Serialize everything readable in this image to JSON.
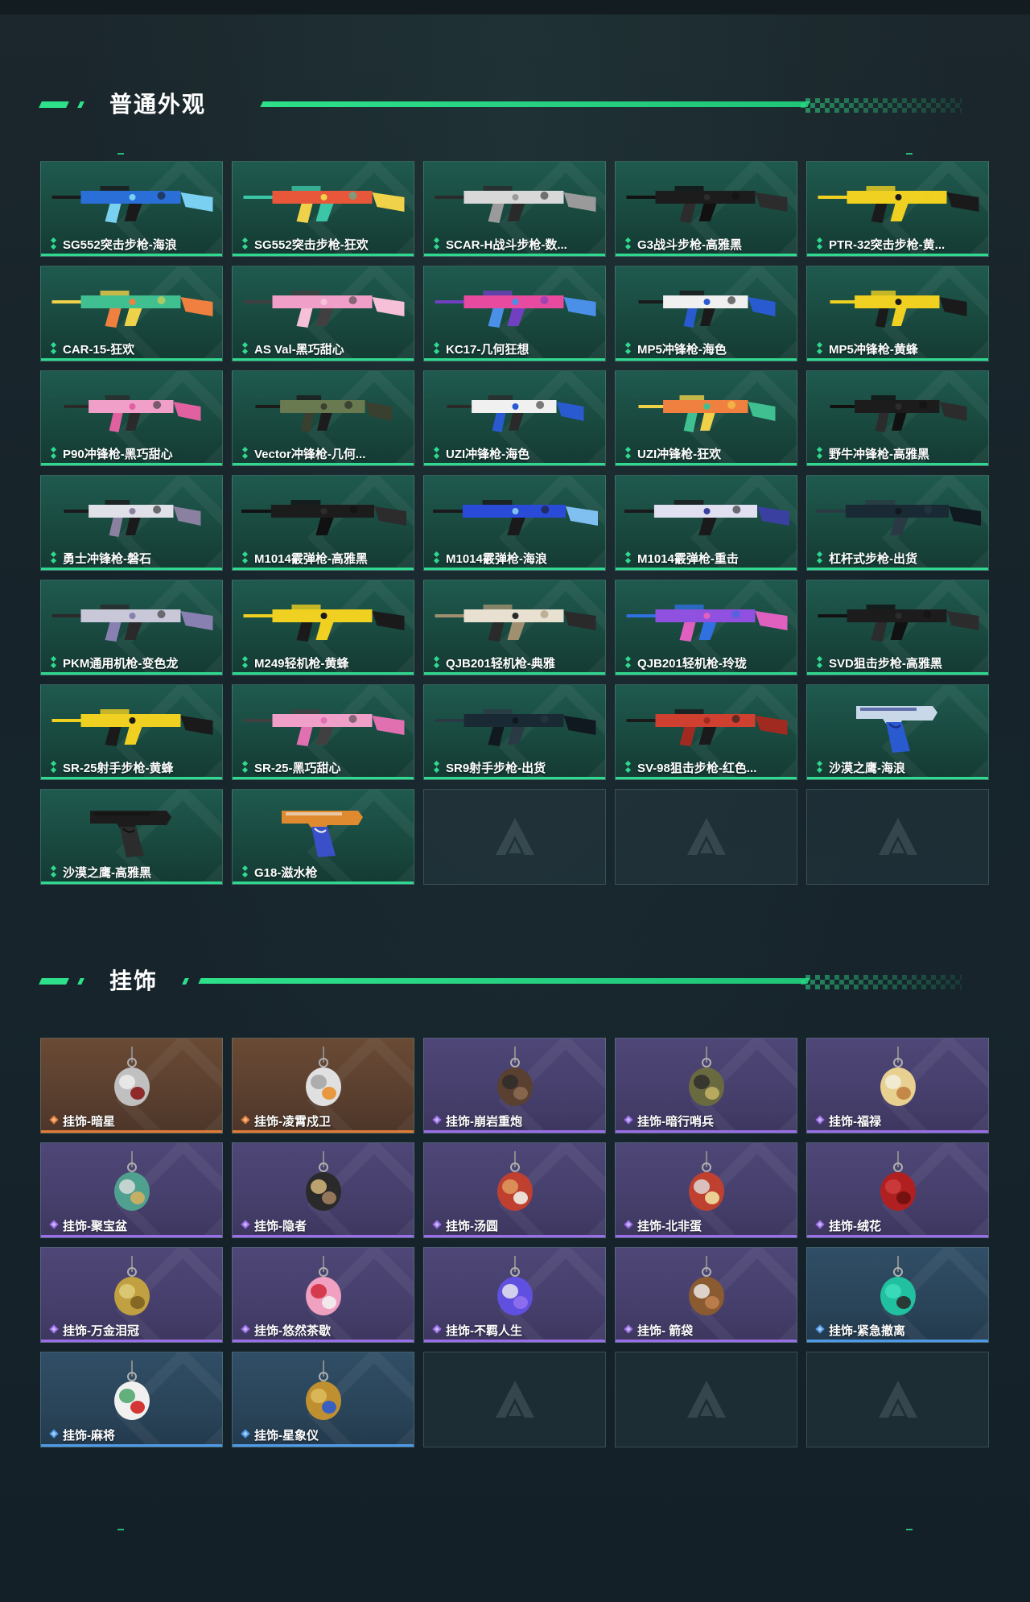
{
  "colors": {
    "accent": "#2ee08a",
    "rarity_green": "#30d98f",
    "rarity_orange": "#e07a35",
    "rarity_purple": "#9a6ee8",
    "rarity_blue": "#4f9ae8"
  },
  "sections": [
    {
      "title": "普通外观",
      "rarity_icon": "green-diamond-icon",
      "items": [
        {
          "label": "SG552突击步枪-海浪",
          "rarity": "green",
          "icon": "assault-rifle-icon",
          "colors": [
            "#2a6fd8",
            "#7ad0f0",
            "#1a1a1a"
          ]
        },
        {
          "label": "SG552突击步枪-狂欢",
          "rarity": "green",
          "icon": "assault-rifle-icon",
          "colors": [
            "#e8573a",
            "#f0d24a",
            "#3cc6a8"
          ]
        },
        {
          "label": "SCAR-H战斗步枪-数...",
          "rarity": "green",
          "icon": "battle-rifle-icon",
          "colors": [
            "#d8d8d8",
            "#9a9a9a",
            "#2a2a2a"
          ]
        },
        {
          "label": "G3战斗步枪-高雅黑",
          "rarity": "green",
          "icon": "battle-rifle-icon",
          "colors": [
            "#1c1c1c",
            "#2c2c2c",
            "#111111"
          ]
        },
        {
          "label": "PTR-32突击步枪-黄...",
          "rarity": "green",
          "icon": "assault-rifle-icon",
          "colors": [
            "#f0d020",
            "#1a1a1a",
            "#f0d020"
          ]
        },
        {
          "label": "CAR-15-狂欢",
          "rarity": "green",
          "icon": "assault-rifle-icon",
          "colors": [
            "#40c090",
            "#f08040",
            "#f0d24a"
          ]
        },
        {
          "label": "AS Val-黑巧甜心",
          "rarity": "green",
          "icon": "assault-rifle-icon",
          "colors": [
            "#f0a0c8",
            "#f6c0d8",
            "#404040"
          ]
        },
        {
          "label": "KC17-几何狂想",
          "rarity": "green",
          "icon": "assault-rifle-icon",
          "colors": [
            "#e84aa0",
            "#4a90e8",
            "#7040c0"
          ]
        },
        {
          "label": "MP5冲锋枪-海色",
          "rarity": "green",
          "icon": "smg-icon",
          "colors": [
            "#f0f0f0",
            "#2a5ad0",
            "#1a1a1a"
          ]
        },
        {
          "label": "MP5冲锋枪-黄蜂",
          "rarity": "green",
          "icon": "smg-icon",
          "colors": [
            "#f0d020",
            "#1a1a1a",
            "#f0d020"
          ]
        },
        {
          "label": "P90冲锋枪-黑巧甜心",
          "rarity": "green",
          "icon": "smg-icon",
          "colors": [
            "#f0a0c8",
            "#e060a0",
            "#2a2a2a"
          ]
        },
        {
          "label": "Vector冲锋枪-几何...",
          "rarity": "green",
          "icon": "smg-icon",
          "colors": [
            "#6a7a50",
            "#3a4030",
            "#1c1c1c"
          ]
        },
        {
          "label": "UZI冲锋枪-海色",
          "rarity": "green",
          "icon": "smg-icon",
          "colors": [
            "#f0f0f0",
            "#2a5ad0",
            "#2a2a2a"
          ]
        },
        {
          "label": "UZI冲锋枪-狂欢",
          "rarity": "green",
          "icon": "smg-icon",
          "colors": [
            "#f08040",
            "#40c090",
            "#f0d24a"
          ]
        },
        {
          "label": "野牛冲锋枪-高雅黑",
          "rarity": "green",
          "icon": "smg-icon",
          "colors": [
            "#1c1c1c",
            "#2c2c2c",
            "#111111"
          ]
        },
        {
          "label": "勇士冲锋枪-磐石",
          "rarity": "green",
          "icon": "smg-icon",
          "colors": [
            "#e0e0e8",
            "#8a80a0",
            "#1a1a1a"
          ]
        },
        {
          "label": "M1014霰弹枪-高雅黑",
          "rarity": "green",
          "icon": "shotgun-icon",
          "colors": [
            "#1c1c1c",
            "#2c2c2c",
            "#111111"
          ]
        },
        {
          "label": "M1014霰弹枪-海浪",
          "rarity": "green",
          "icon": "shotgun-icon",
          "colors": [
            "#2a4ad8",
            "#80c0f0",
            "#1a1a1a"
          ]
        },
        {
          "label": "M1014霰弹枪-重击",
          "rarity": "green",
          "icon": "shotgun-icon",
          "colors": [
            "#e0e0f0",
            "#3a40a0",
            "#1a1a1a"
          ]
        },
        {
          "label": "杠杆式步枪-出货",
          "rarity": "green",
          "icon": "lever-rifle-icon",
          "colors": [
            "#1a2a34",
            "#101820",
            "#2a3a44"
          ]
        },
        {
          "label": "PKM通用机枪-变色龙",
          "rarity": "green",
          "icon": "machine-gun-icon",
          "colors": [
            "#c8c8d8",
            "#8880b0",
            "#2a2a2a"
          ]
        },
        {
          "label": "M249轻机枪-黄蜂",
          "rarity": "green",
          "icon": "machine-gun-icon",
          "colors": [
            "#f0d020",
            "#1a1a1a",
            "#f0d020"
          ]
        },
        {
          "label": "QJB201轻机枪-典雅",
          "rarity": "green",
          "icon": "machine-gun-icon",
          "colors": [
            "#e8e0d0",
            "#2a2a2a",
            "#a09070"
          ]
        },
        {
          "label": "QJB201轻机枪-玲珑",
          "rarity": "green",
          "icon": "machine-gun-icon",
          "colors": [
            "#9050e0",
            "#e060c0",
            "#3070e0"
          ]
        },
        {
          "label": "SVD狙击步枪-高雅黑",
          "rarity": "green",
          "icon": "sniper-rifle-icon",
          "colors": [
            "#1c1c1c",
            "#2c2c2c",
            "#111111"
          ]
        },
        {
          "label": "SR-25射手步枪-黄蜂",
          "rarity": "green",
          "icon": "sniper-rifle-icon",
          "colors": [
            "#f0d020",
            "#1a1a1a",
            "#f0d020"
          ]
        },
        {
          "label": "SR-25-黑巧甜心",
          "rarity": "green",
          "icon": "sniper-rifle-icon",
          "colors": [
            "#f0a0c8",
            "#e070b0",
            "#404040"
          ]
        },
        {
          "label": "SR9射手步枪-出货",
          "rarity": "green",
          "icon": "sniper-rifle-icon",
          "colors": [
            "#1a2a34",
            "#101820",
            "#2a3a44"
          ]
        },
        {
          "label": "SV-98狙击步枪-红色...",
          "rarity": "green",
          "icon": "sniper-rifle-icon",
          "colors": [
            "#d04030",
            "#a02a20",
            "#1a1a1a"
          ]
        },
        {
          "label": "沙漠之鹰-海浪",
          "rarity": "green",
          "icon": "pistol-icon",
          "colors": [
            "#c8d8e8",
            "#2a5ad0",
            "#1a2a80"
          ]
        },
        {
          "label": "沙漠之鹰-高雅黑",
          "rarity": "green",
          "icon": "pistol-icon",
          "colors": [
            "#1c1c1c",
            "#2c2c2c",
            "#111111"
          ]
        },
        {
          "label": "G18-滋水枪",
          "rarity": "green",
          "icon": "pistol-icon",
          "colors": [
            "#e08a30",
            "#3a50c8",
            "#f0f0f0"
          ]
        }
      ],
      "empty_slots": 3
    },
    {
      "title": "挂饰",
      "items": [
        {
          "label": "挂饰-暗星",
          "rarity": "orange",
          "icon": "charm-icon",
          "colors": [
            "#c0c0c0",
            "#8a1a1a",
            "#f0f0f0"
          ]
        },
        {
          "label": "挂饰-凌霄戍卫",
          "rarity": "orange",
          "icon": "charm-icon",
          "colors": [
            "#e0e0e0",
            "#e89030",
            "#a0a0a0"
          ]
        },
        {
          "label": "挂饰-崩岩重炮",
          "rarity": "purple",
          "icon": "charm-icon",
          "colors": [
            "#5a4030",
            "#8a6a50",
            "#2a2a2a"
          ]
        },
        {
          "label": "挂饰-暗行哨兵",
          "rarity": "purple",
          "icon": "charm-icon",
          "colors": [
            "#6a6a40",
            "#c0b060",
            "#2a2a2a"
          ]
        },
        {
          "label": "挂饰-福禄",
          "rarity": "purple",
          "icon": "charm-icon",
          "colors": [
            "#e8d090",
            "#c08040",
            "#f0f0e0"
          ]
        },
        {
          "label": "挂饰-聚宝盆",
          "rarity": "purple",
          "icon": "charm-icon",
          "colors": [
            "#50a090",
            "#d0b060",
            "#e0e0e0"
          ]
        },
        {
          "label": "挂饰-隐者",
          "rarity": "purple",
          "icon": "charm-icon",
          "colors": [
            "#2a2a2a",
            "#a08060",
            "#e0c080"
          ]
        },
        {
          "label": "挂饰-汤圆",
          "rarity": "purple",
          "icon": "charm-icon",
          "colors": [
            "#c04030",
            "#f0f0e8",
            "#e0a060"
          ]
        },
        {
          "label": "挂饰-北非蛋",
          "rarity": "purple",
          "icon": "charm-icon",
          "colors": [
            "#c04030",
            "#f0e0a0",
            "#e0e0e0"
          ]
        },
        {
          "label": "挂饰-绒花",
          "rarity": "purple",
          "icon": "charm-icon",
          "colors": [
            "#b02020",
            "#701010",
            "#d04040"
          ]
        },
        {
          "label": "挂饰-万金泪冠",
          "rarity": "purple",
          "icon": "charm-icon",
          "colors": [
            "#c0a040",
            "#806020",
            "#e0d080"
          ]
        },
        {
          "label": "挂饰-悠然茶歇",
          "rarity": "purple",
          "icon": "charm-icon",
          "colors": [
            "#f0a0c0",
            "#f0f0f0",
            "#d02030"
          ]
        },
        {
          "label": "挂饰-不羁人生",
          "rarity": "purple",
          "icon": "charm-icon",
          "colors": [
            "#6050e0",
            "#9070f0",
            "#f0f0f0"
          ]
        },
        {
          "label": "挂饰- 箭袋",
          "rarity": "purple",
          "icon": "charm-icon",
          "colors": [
            "#8a5a30",
            "#c08050",
            "#f0f0f0"
          ]
        },
        {
          "label": "挂饰-紧急撤离",
          "rarity": "blue",
          "icon": "charm-icon",
          "colors": [
            "#20c0a0",
            "#2a2a2a",
            "#40e0c0"
          ]
        },
        {
          "label": "挂饰-麻将",
          "rarity": "blue",
          "icon": "charm-icon",
          "colors": [
            "#f0f0f0",
            "#d02020",
            "#40a060"
          ]
        },
        {
          "label": "挂饰-星象仪",
          "rarity": "blue",
          "icon": "charm-icon",
          "colors": [
            "#c09030",
            "#2a5ad0",
            "#e0c060"
          ]
        }
      ],
      "empty_slots": 3
    }
  ]
}
